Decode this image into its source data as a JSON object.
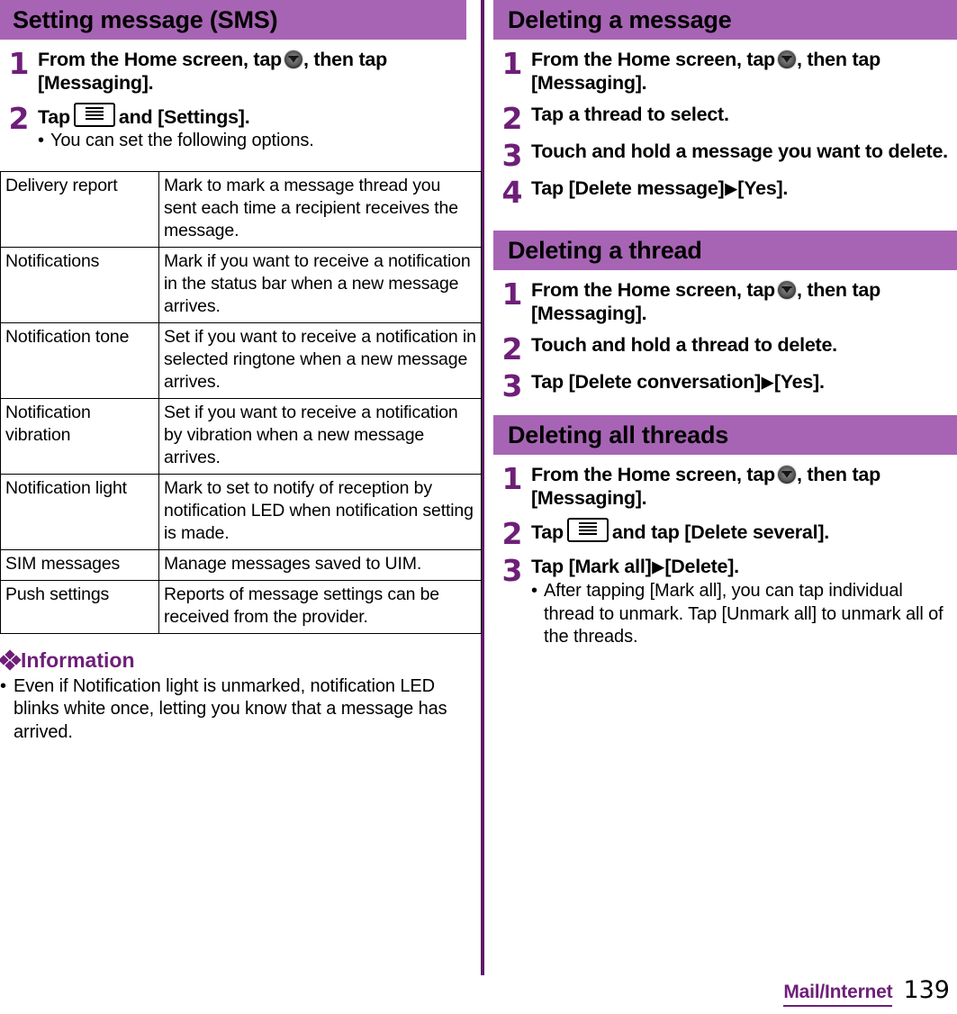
{
  "theme": {
    "header_band": "#A764B4",
    "accent_purple": "#6E1F78",
    "divider": "#5E1A66"
  },
  "icons": {
    "launcher": "app-launcher-icon",
    "menu_key": "menu-key-icon",
    "arrow": "▶",
    "bullet": "•",
    "diamonds": "❖"
  },
  "left_column": {
    "section": {
      "title": "Setting message (SMS)",
      "steps": [
        {
          "num": "1",
          "text_before": "From the Home screen, tap",
          "text_after": ", then tap [Messaging]."
        },
        {
          "num": "2",
          "text_before": "Tap",
          "text_after": "and [Settings].",
          "notes": [
            "You can set the following options."
          ]
        }
      ]
    },
    "options_table": {
      "rows": [
        {
          "name": "Delivery report",
          "description": "Mark to mark a message thread you sent each time a recipient receives the message."
        },
        {
          "name": "Notifications",
          "description": "Mark if you want to receive a notification in the status bar when a new message arrives."
        },
        {
          "name": "Notification tone",
          "description": "Set if you want to receive a notification in selected ringtone when a new message arrives."
        },
        {
          "name": "Notification vibration",
          "description": "Set if you want to receive a notification by vibration when a new message arrives."
        },
        {
          "name": "Notification light",
          "description": "Mark to set to notify of reception by notification LED when notification setting is made."
        },
        {
          "name": "SIM messages",
          "description": "Manage messages saved to UIM."
        },
        {
          "name": "Push settings",
          "description": "Reports of message settings can be received from the provider."
        }
      ]
    },
    "information": {
      "heading": "Information",
      "items": [
        "Even if Notification light is unmarked, notification LED blinks white once, letting you know that a message has arrived."
      ]
    }
  },
  "right_column": {
    "sections": [
      {
        "title": "Deleting a message",
        "steps": [
          {
            "num": "1",
            "text_before": "From the Home screen, tap",
            "text_after": ", then tap [Messaging]."
          },
          {
            "num": "2",
            "text_before": "Tap a thread to select."
          },
          {
            "num": "3",
            "text_before": "Touch and hold a message you want to delete."
          },
          {
            "num": "4",
            "text_before": "Tap [Delete message]",
            "text_after": "[Yes]."
          }
        ]
      },
      {
        "title": "Deleting a thread",
        "steps": [
          {
            "num": "1",
            "text_before": "From the Home screen, tap",
            "text_after": ", then tap [Messaging]."
          },
          {
            "num": "2",
            "text_before": "Touch and hold a thread to delete."
          },
          {
            "num": "3",
            "text_before": "Tap [Delete conversation]",
            "text_after": "[Yes]."
          }
        ]
      },
      {
        "title": "Deleting all threads",
        "steps": [
          {
            "num": "1",
            "text_before": "From the Home screen, tap",
            "text_after": ", then tap [Messaging]."
          },
          {
            "num": "2",
            "text_before": "Tap",
            "text_after": "and tap [Delete several]."
          },
          {
            "num": "3",
            "text_before": "Tap [Mark all]",
            "text_after": "[Delete].",
            "notes": [
              "After tapping [Mark all], you can tap individual thread to unmark. Tap [Unmark all] to unmark all of the threads."
            ]
          }
        ]
      }
    ]
  },
  "footer": {
    "section_label": "Mail/Internet",
    "page_number": "139"
  }
}
